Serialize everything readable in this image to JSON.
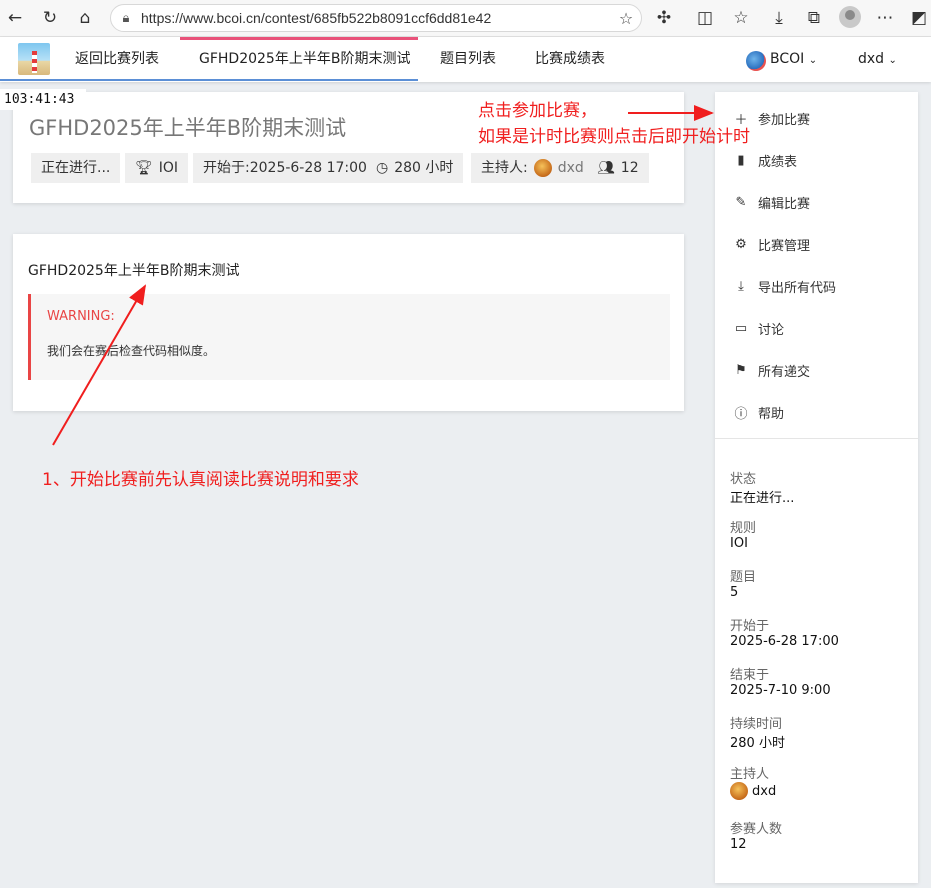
{
  "browser": {
    "url": "https://www.bcoi.cn/contest/685fb522b8091ccf6dd81e42"
  },
  "nav": {
    "back_to_list": "返回比赛列表",
    "contest_tab": "GFHD2025年上半年B阶期末测试",
    "problems": "题目列表",
    "scoreboard": "比赛成绩表",
    "domain": "BCOI",
    "user": "dxd"
  },
  "timer": "103:41:43",
  "contest": {
    "title": "GFHD2025年上半年B阶期末测试",
    "status": "正在进行...",
    "rule": "IOI",
    "start": "开始于:2025-6-28 17:00",
    "duration": "280 小时",
    "host_label": "主持人:",
    "host": "dxd",
    "participants": "12"
  },
  "description": {
    "title": "GFHD2025年上半年B阶期末测试",
    "warning_title": "WARNING:",
    "warning_text": "我们会在赛后检查代码相似度。"
  },
  "sidebar": {
    "actions": [
      {
        "label": "参加比赛",
        "icon": "plus-icon"
      },
      {
        "label": "成绩表",
        "icon": "bar-chart-icon"
      },
      {
        "label": "编辑比赛",
        "icon": "pencil-icon"
      },
      {
        "label": "比赛管理",
        "icon": "gear-icon"
      },
      {
        "label": "导出所有代码",
        "icon": "download-icon"
      },
      {
        "label": "讨论",
        "icon": "comment-icon"
      },
      {
        "label": "所有递交",
        "icon": "flag-icon"
      },
      {
        "label": "帮助",
        "icon": "help-icon"
      }
    ],
    "info": [
      {
        "label": "状态",
        "value": "正在进行..."
      },
      {
        "label": "规则",
        "value": "IOI"
      },
      {
        "label": "题目",
        "value": "5"
      },
      {
        "label": "开始于",
        "value": "2025-6-28 17:00"
      },
      {
        "label": "结束于",
        "value": "2025-7-10 9:00"
      },
      {
        "label": "持续时间",
        "value": "280 小时"
      },
      {
        "label": "主持人",
        "value": "dxd"
      },
      {
        "label": "参赛人数",
        "value": "12"
      }
    ]
  },
  "annotations": {
    "join_line1": "点击参加比赛，",
    "join_line2": "如果是计时比赛则点击后即开始计时",
    "read_hint": "1、开始比赛前先认真阅读比赛说明和要求"
  },
  "colors": {
    "annotation": "#f01e1e",
    "warning": "#e94545",
    "nav_active": "#e9527a"
  }
}
